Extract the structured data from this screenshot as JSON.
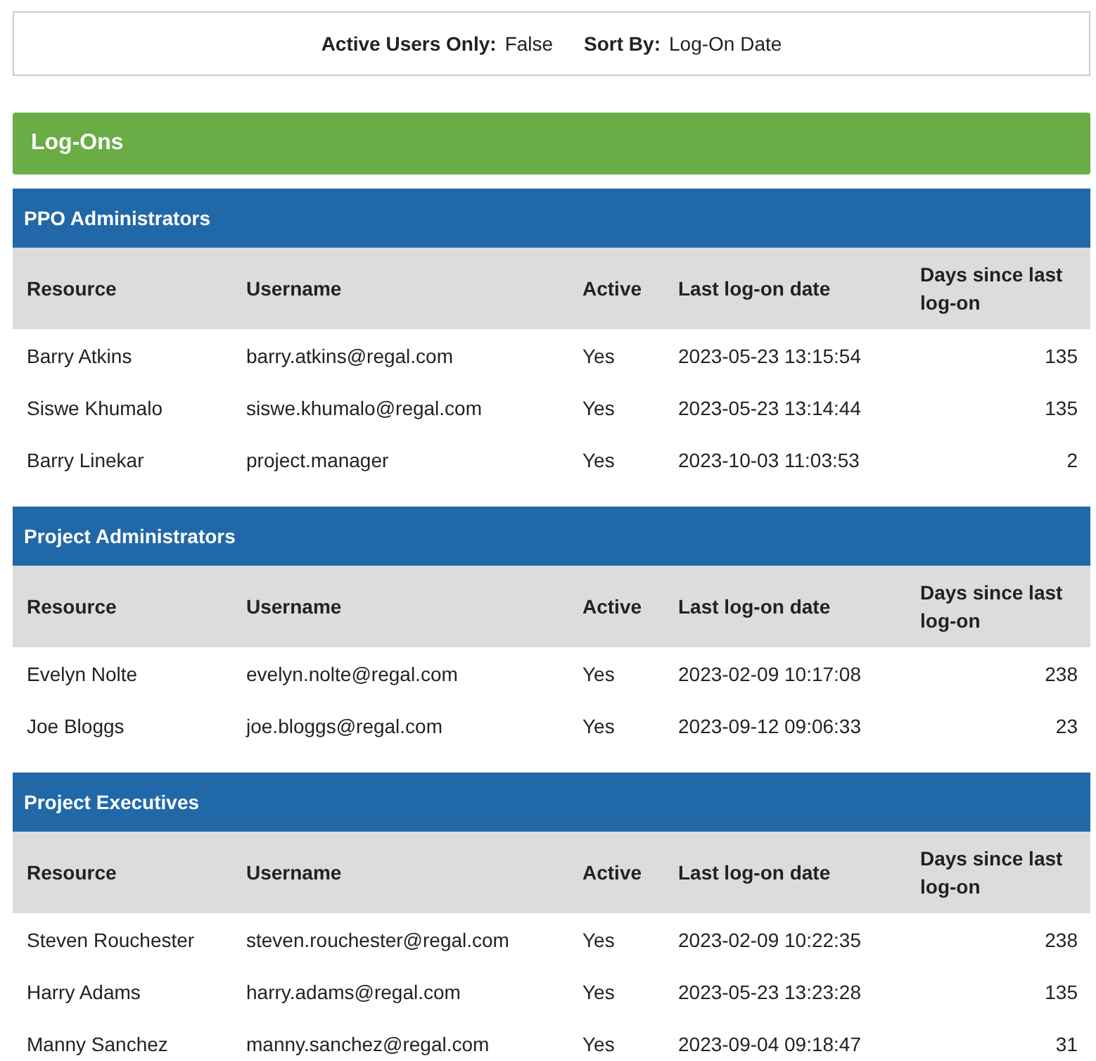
{
  "filters": [
    {
      "label": "Active Users Only:",
      "value": "False"
    },
    {
      "label": "Sort By:",
      "value": "Log-On Date"
    }
  ],
  "title": "Log-Ons",
  "groups": [
    {
      "name": "PPO Administrators",
      "columns": [
        "Resource",
        "Username",
        "Active",
        "Last log-on date",
        "Days since last log-on"
      ],
      "rows": [
        {
          "resource": "Barry Atkins",
          "username": "barry.atkins@regal.com",
          "active": "Yes",
          "last": "2023-05-23 13:15:54",
          "days": "135"
        },
        {
          "resource": "Siswe Khumalo",
          "username": "siswe.khumalo@regal.com",
          "active": "Yes",
          "last": "2023-05-23 13:14:44",
          "days": "135"
        },
        {
          "resource": "Barry Linekar",
          "username": "project.manager",
          "active": "Yes",
          "last": "2023-10-03 11:03:53",
          "days": "2"
        }
      ]
    },
    {
      "name": "Project Administrators",
      "columns": [
        "Resource",
        "Username",
        "Active",
        "Last log-on date",
        "Days since last log-on"
      ],
      "rows": [
        {
          "resource": "Evelyn Nolte",
          "username": "evelyn.nolte@regal.com",
          "active": "Yes",
          "last": "2023-02-09 10:17:08",
          "days": "238"
        },
        {
          "resource": "Joe Bloggs",
          "username": "joe.bloggs@regal.com",
          "active": "Yes",
          "last": "2023-09-12 09:06:33",
          "days": "23"
        }
      ]
    },
    {
      "name": "Project Executives",
      "columns": [
        "Resource",
        "Username",
        "Active",
        "Last log-on date",
        "Days since last log-on"
      ],
      "rows": [
        {
          "resource": "Steven Rouchester",
          "username": "steven.rouchester@regal.com",
          "active": "Yes",
          "last": "2023-02-09 10:22:35",
          "days": "238"
        },
        {
          "resource": "Harry Adams",
          "username": "harry.adams@regal.com",
          "active": "Yes",
          "last": "2023-05-23 13:23:28",
          "days": "135"
        },
        {
          "resource": "Manny Sanchez",
          "username": "manny.sanchez@regal.com",
          "active": "Yes",
          "last": "2023-09-04 09:18:47",
          "days": "31"
        }
      ]
    }
  ]
}
